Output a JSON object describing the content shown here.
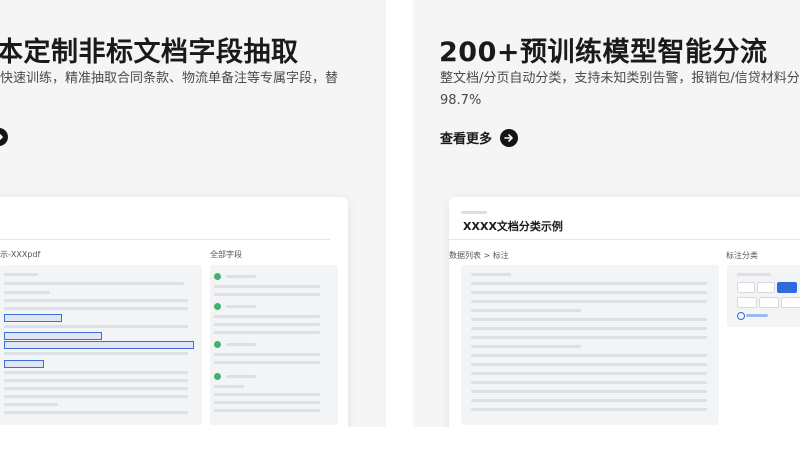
{
  "left_card": {
    "title": "本定制非标文档字段抽取",
    "description": "快速训练，精准抽取合同条款、物流单备注等专属字段，替",
    "mock": {
      "file_label": "示-XXXpdf",
      "panel_label": "全部字段"
    }
  },
  "right_card": {
    "title": "200+预训练模型智能分流",
    "description_line1": "整文档/分页自动分类，支持未知类别告警，报销包/信贷材料分",
    "description_line2": "98.7%",
    "more_label": "查看更多",
    "mock": {
      "doc_title": "XXXX文档分类示例",
      "breadcrumb": "数据列表 > 标注",
      "panel_label": "标注分类"
    }
  },
  "colors": {
    "card_bg": "#f5f5f5",
    "accent_blue": "#2f6bdc",
    "check_green": "#3bb56b"
  }
}
